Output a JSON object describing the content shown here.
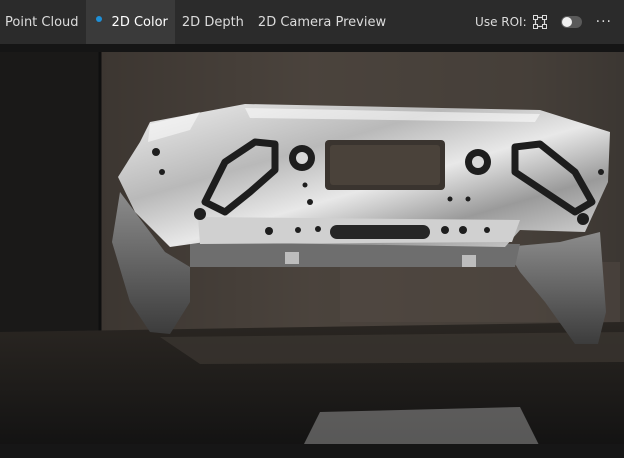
{
  "tabs": [
    {
      "label": "Point Cloud",
      "active": false
    },
    {
      "label": "2D Color",
      "active": true
    },
    {
      "label": "2D Depth",
      "active": false
    },
    {
      "label": "2D Camera Preview",
      "active": false
    }
  ],
  "roi": {
    "label": "Use ROI:",
    "enabled": false
  },
  "menu": {
    "more_label": "···"
  },
  "colors": {
    "active_dot": "#1e90d8",
    "topbar": "#2b2b2b",
    "active_tab": "#3a3a3a"
  },
  "icons": {
    "roi": "roi-selection-icon",
    "more": "more-options-icon"
  }
}
